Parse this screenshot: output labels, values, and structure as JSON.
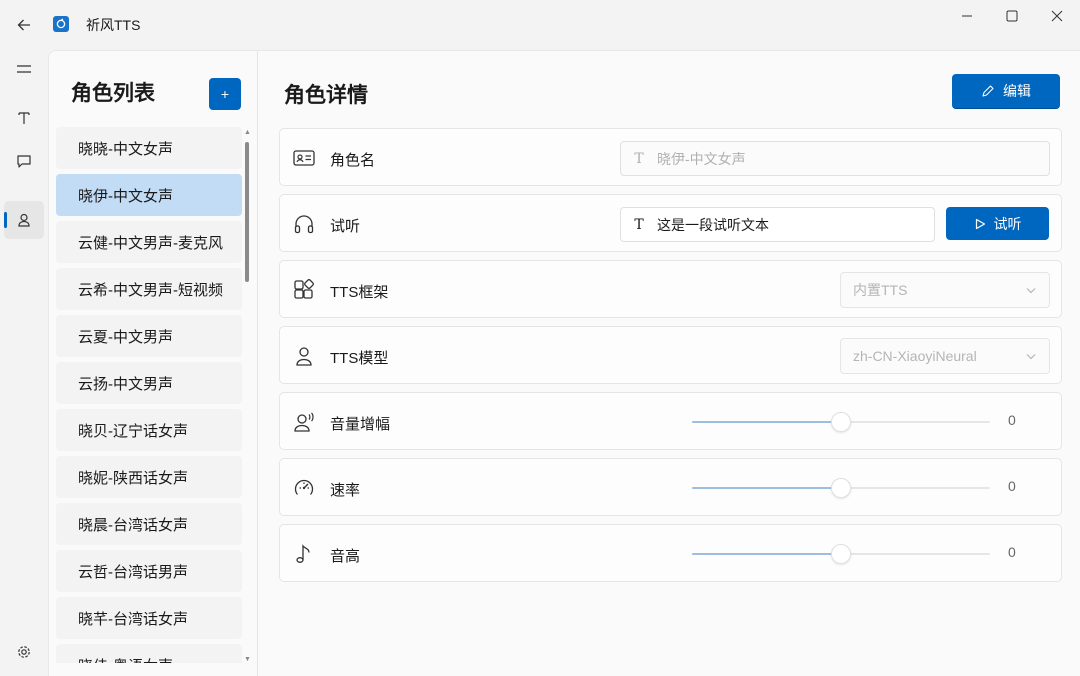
{
  "app": {
    "title": "祈风TTS",
    "accent": "#0067c0"
  },
  "list_panel": {
    "title": "角色列表",
    "add_label": "+",
    "roles": [
      "晓晓-中文女声",
      "晓伊-中文女声",
      "云健-中文男声-麦克风",
      "云希-中文男声-短视频",
      "云夏-中文男声",
      "云扬-中文男声",
      "晓贝-辽宁话女声",
      "晓妮-陕西话女声",
      "晓晨-台湾话女声",
      "云哲-台湾话男声",
      "晓芊-台湾话女声",
      "晓佳-粤语女声"
    ],
    "selected_index": 1
  },
  "detail": {
    "title": "角色详情",
    "edit_label": "编辑",
    "name": {
      "label": "角色名",
      "placeholder": "晓伊-中文女声"
    },
    "audition": {
      "label": "试听",
      "value": "这是一段试听文本",
      "button_label": "试听"
    },
    "framework": {
      "label": "TTS框架",
      "value": "内置TTS"
    },
    "model": {
      "label": "TTS模型",
      "value": "zh-CN-XiaoyiNeural"
    },
    "volume": {
      "label": "音量增幅",
      "value": "0",
      "fill_fraction": 0.5
    },
    "rate": {
      "label": "速率",
      "value": "0",
      "fill_fraction": 0.5
    },
    "pitch": {
      "label": "音高",
      "value": "0",
      "fill_fraction": 0.5
    }
  },
  "icons": {
    "back": "back-arrow-icon",
    "menu": "hamburger-icon",
    "text": "text-icon",
    "chat": "chat-icon",
    "person": "person-icon",
    "settings": "gear-icon"
  }
}
